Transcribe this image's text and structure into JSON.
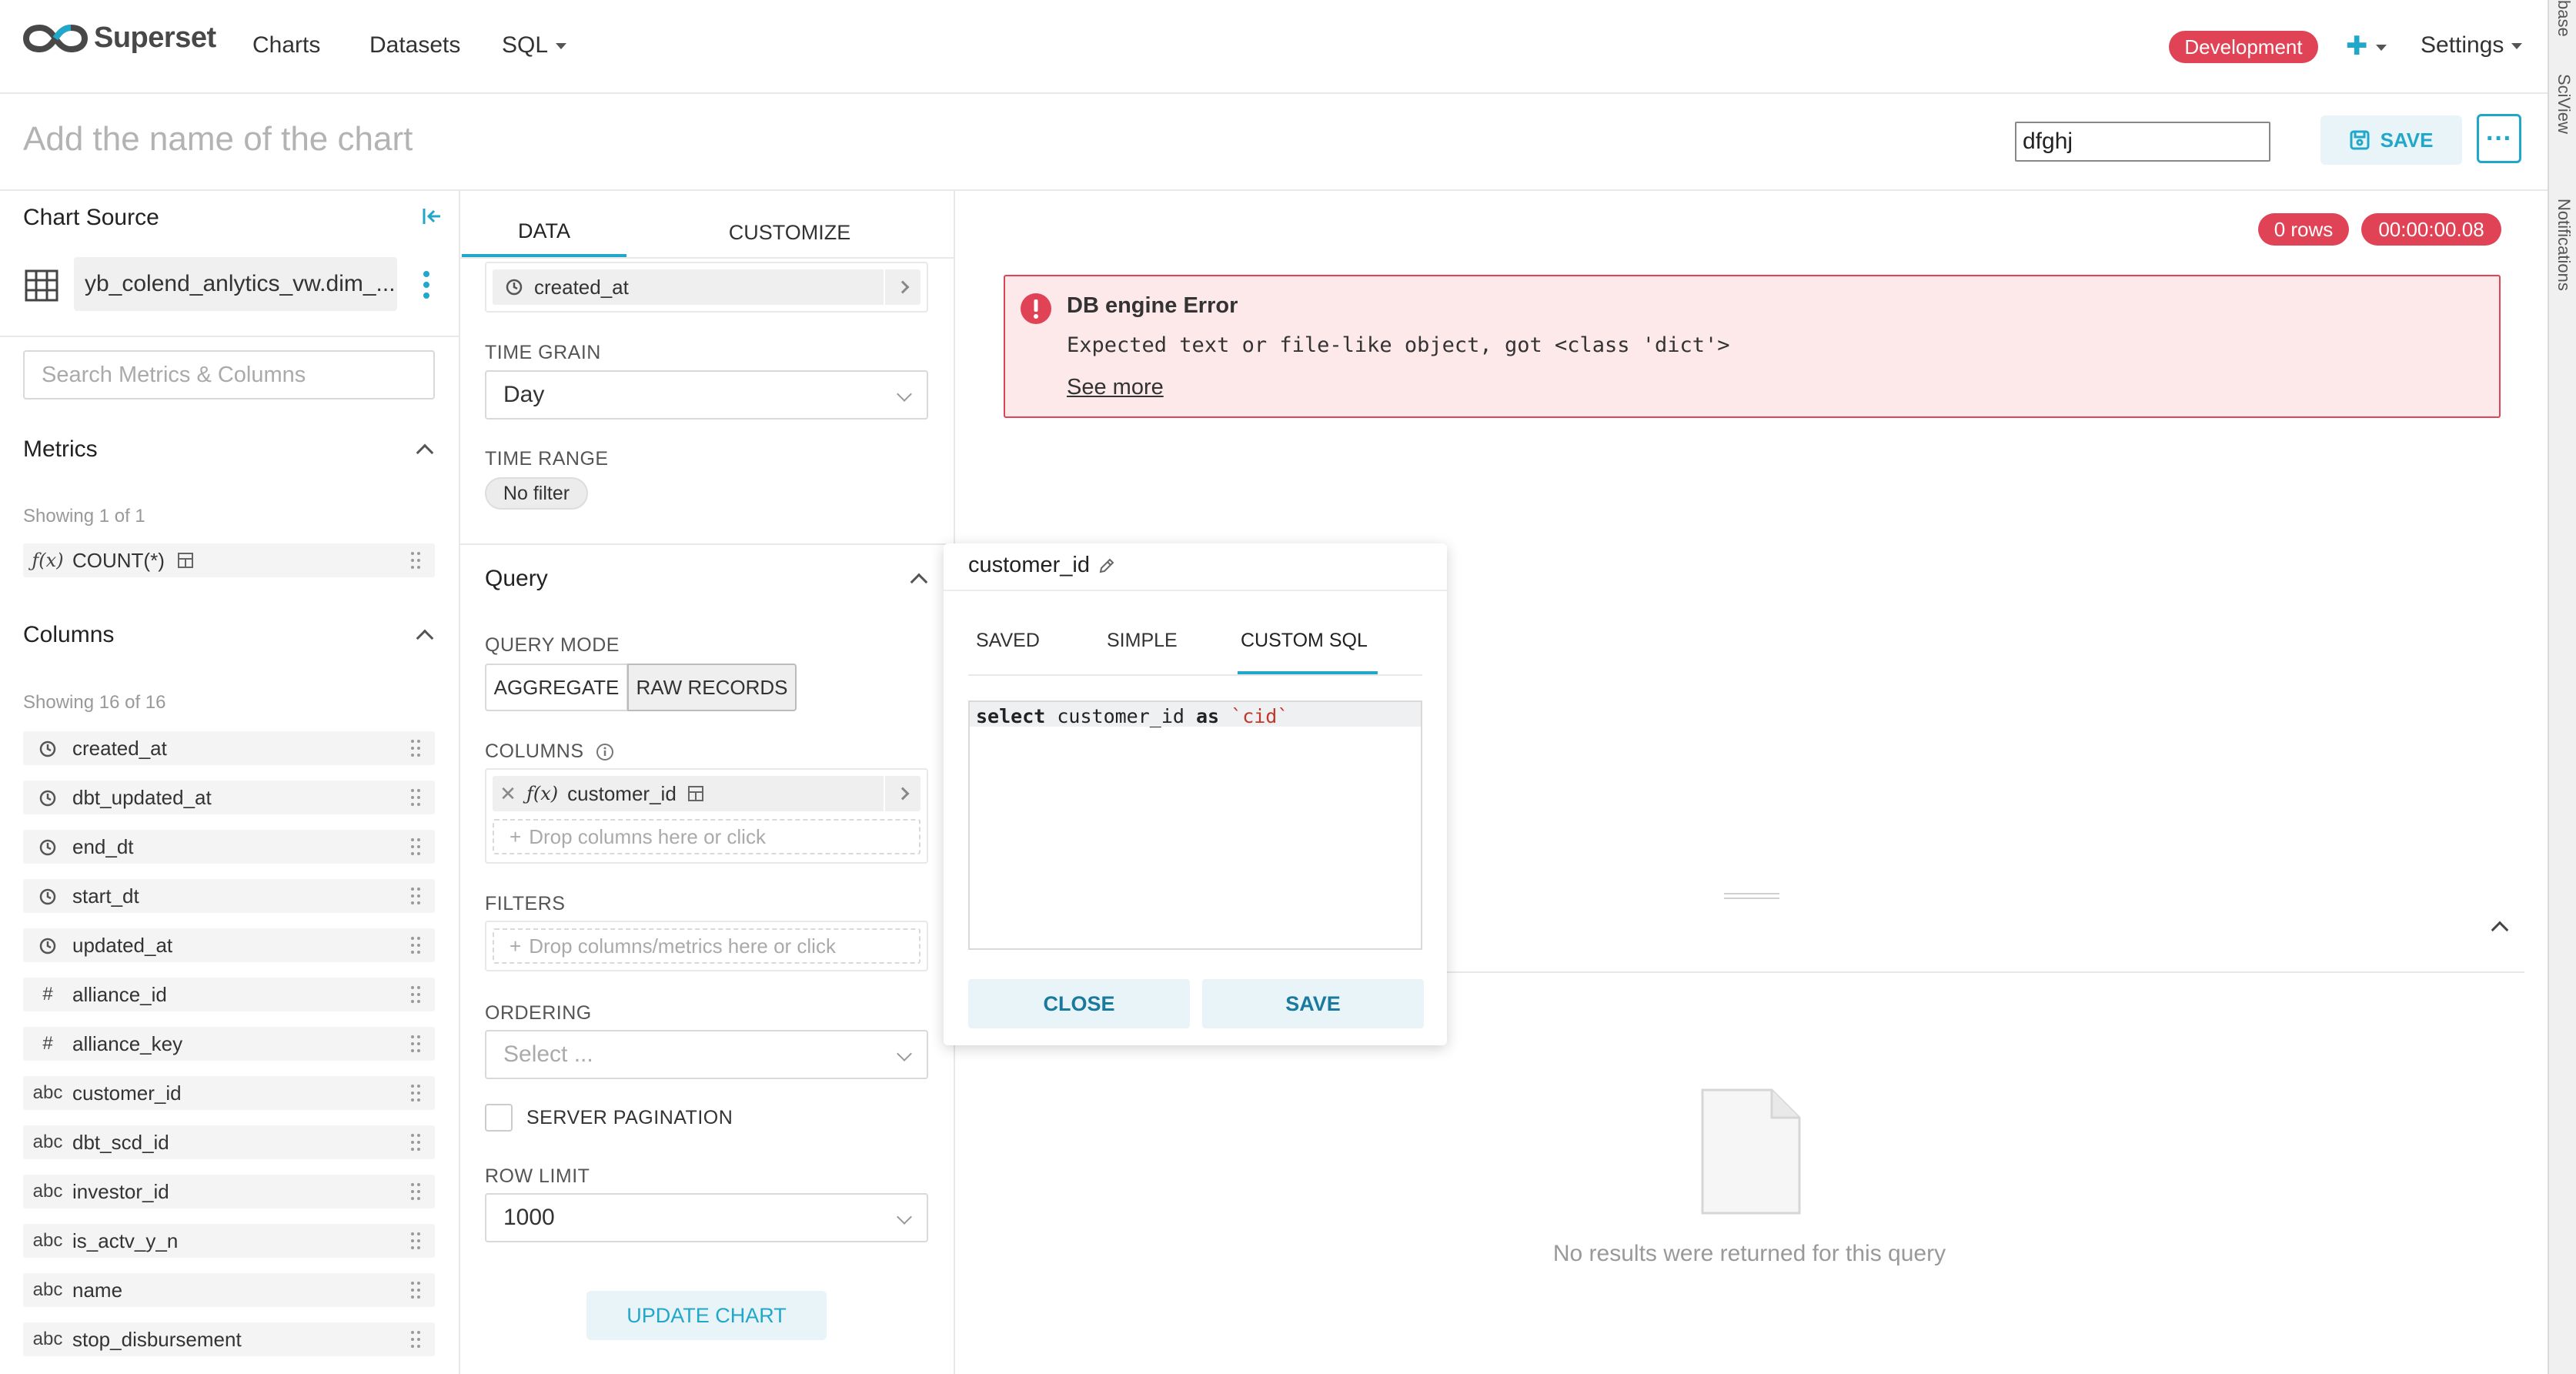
{
  "nav": {
    "brand": "Superset",
    "links": [
      "Charts",
      "Datasets",
      "SQL"
    ],
    "env_badge": "Development",
    "settings": "Settings"
  },
  "header": {
    "chart_name_placeholder": "Add the name of the chart",
    "input_value": "dfghj",
    "save_label": "SAVE",
    "more_label": "···"
  },
  "left": {
    "title": "Chart Source",
    "dataset": "yb_colend_anlytics_vw.dim_...",
    "search_placeholder": "Search Metrics & Columns",
    "metrics_title": "Metrics",
    "metrics_showing": "Showing 1 of 1",
    "metric_label": "COUNT(*)",
    "columns_title": "Columns",
    "columns_showing": "Showing 16 of 16",
    "columns": [
      {
        "type": "clock",
        "name": "created_at"
      },
      {
        "type": "clock",
        "name": "dbt_updated_at"
      },
      {
        "type": "clock",
        "name": "end_dt"
      },
      {
        "type": "clock",
        "name": "start_dt"
      },
      {
        "type": "clock",
        "name": "updated_at"
      },
      {
        "type": "#",
        "name": "alliance_id"
      },
      {
        "type": "#",
        "name": "alliance_key"
      },
      {
        "type": "abc",
        "name": "customer_id"
      },
      {
        "type": "abc",
        "name": "dbt_scd_id"
      },
      {
        "type": "abc",
        "name": "investor_id"
      },
      {
        "type": "abc",
        "name": "is_actv_y_n"
      },
      {
        "type": "abc",
        "name": "name"
      },
      {
        "type": "abc",
        "name": "stop_disbursement"
      }
    ]
  },
  "middle": {
    "tab_data": "DATA",
    "tab_customize": "CUSTOMIZE",
    "temporal_column": "created_at",
    "time_grain_label": "TIME GRAIN",
    "time_grain_value": "Day",
    "time_range_label": "TIME RANGE",
    "time_range_value": "No filter",
    "query_title": "Query",
    "query_mode_label": "QUERY MODE",
    "mode_aggregate": "AGGREGATE",
    "mode_raw": "RAW RECORDS",
    "columns_label": "COLUMNS",
    "column_value": "customer_id",
    "columns_drop": "Drop columns here or click",
    "filters_label": "FILTERS",
    "filters_drop": "Drop columns/metrics here or click",
    "ordering_label": "ORDERING",
    "ordering_placeholder": "Select ...",
    "server_pagination": "SERVER PAGINATION",
    "row_limit_label": "ROW LIMIT",
    "row_limit_value": "1000",
    "update_chart": "UPDATE CHART"
  },
  "right": {
    "rows_badge": "0 rows",
    "time_badge": "00:00:00.08",
    "error_title": "DB engine Error",
    "error_message": "Expected text or file-like object, got <class 'dict'>",
    "error_more": "See more",
    "no_results": "No results were returned for this query"
  },
  "popover": {
    "title": "customer_id",
    "tabs": [
      "SAVED",
      "SIMPLE",
      "CUSTOM SQL"
    ],
    "sql_kw1": "select",
    "sql_mid": " customer_id ",
    "sql_kw2": "as",
    "sql_str": " `cid`",
    "close": "CLOSE",
    "save": "SAVE"
  },
  "side_strip": {
    "labels": [
      "base",
      "SciView",
      "Notifications"
    ]
  },
  "colors": {
    "accent": "#20a7c9",
    "danger": "#e04355",
    "error_bg": "#fde8ea"
  }
}
